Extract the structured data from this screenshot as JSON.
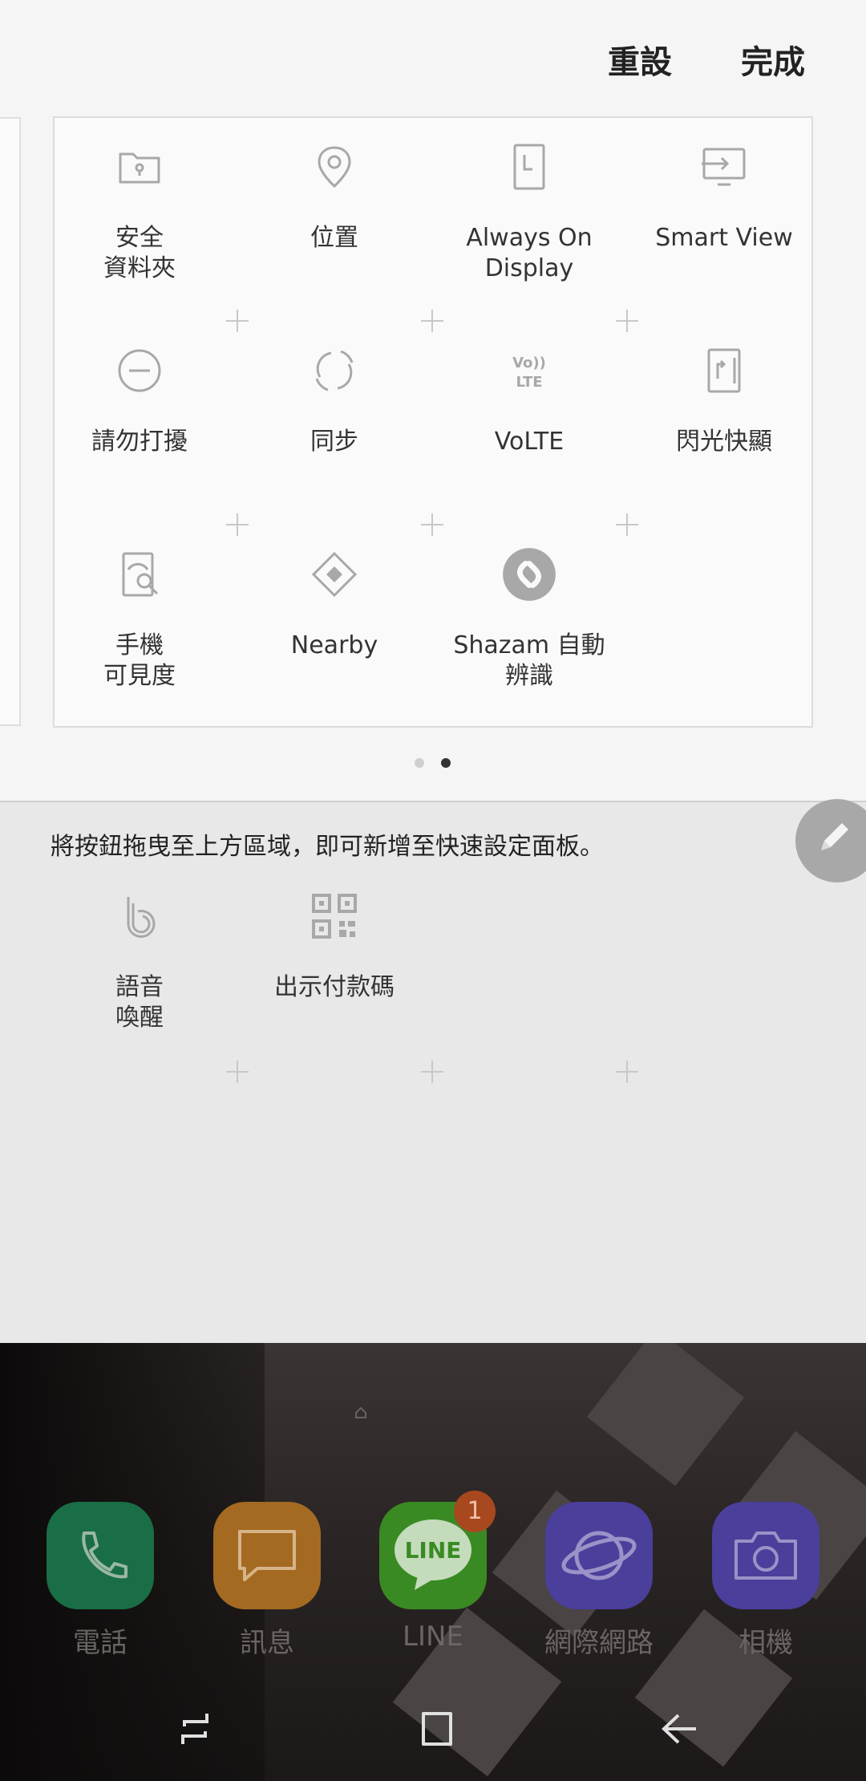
{
  "header": {
    "reset_label": "重設",
    "done_label": "完成"
  },
  "active_tiles": [
    {
      "label": "安全\n資料夾",
      "icon": "secure-folder-icon"
    },
    {
      "label": "位置",
      "icon": "location-pin-icon"
    },
    {
      "label": "Always On\nDisplay",
      "icon": "always-on-display-icon"
    },
    {
      "label": "Smart View",
      "icon": "smart-view-icon"
    },
    {
      "label": "請勿打擾",
      "icon": "do-not-disturb-icon"
    },
    {
      "label": "同步",
      "icon": "sync-icon"
    },
    {
      "label": "VoLTE",
      "icon": "volte-icon"
    },
    {
      "label": "閃光快顯",
      "icon": "edge-flash-icon"
    },
    {
      "label": "手機\n可見度",
      "icon": "phone-visibility-icon"
    },
    {
      "label": "Nearby",
      "icon": "nearby-icon"
    },
    {
      "label": "Shazam 自動\n辨識",
      "icon": "shazam-icon"
    }
  ],
  "pagination": {
    "pages": 2,
    "current": 2
  },
  "tray": {
    "instruction": "將按鈕拖曳至上方區域，即可新增至快速設定面板。",
    "tiles": [
      {
        "label": "語音\n喚醒",
        "icon": "bixby-voice-icon"
      },
      {
        "label": "出示付款碼",
        "icon": "qr-code-icon"
      }
    ]
  },
  "dock": {
    "apps": [
      {
        "label": "電話",
        "icon": "phone-icon",
        "color": "#1a6e45"
      },
      {
        "label": "訊息",
        "icon": "messages-icon",
        "color": "#a46a22"
      },
      {
        "label": "LINE",
        "icon": "line-icon",
        "color": "#3a8a24",
        "badge": "1"
      },
      {
        "label": "網際網路",
        "icon": "internet-icon",
        "color": "#4a3f9a"
      },
      {
        "label": "相機",
        "icon": "camera-icon",
        "color": "#4a3f9a"
      }
    ]
  },
  "nav": {
    "recents": "recents-icon",
    "home": "home-icon",
    "back": "back-icon"
  }
}
